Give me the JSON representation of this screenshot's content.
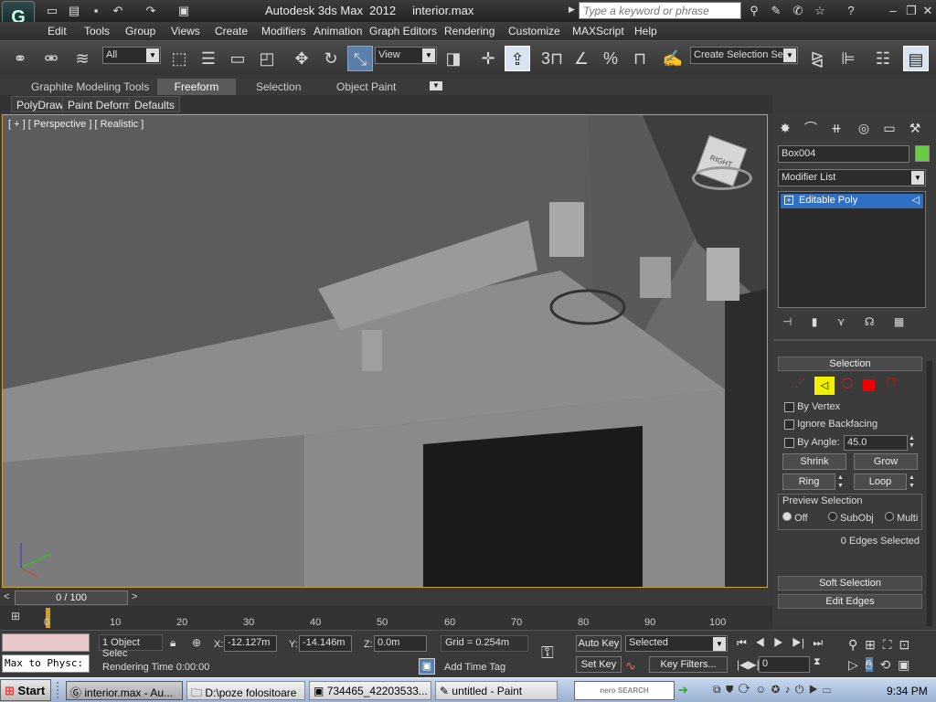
{
  "title": {
    "app": "Autodesk 3ds Max  2012",
    "file": "interior.max",
    "search_placeholder": "Type a keyword or phrase"
  },
  "menu": [
    "Edit",
    "Tools",
    "Group",
    "Views",
    "Create",
    "Modifiers",
    "Animation",
    "Graph Editors",
    "Rendering",
    "Customize",
    "MAXScript",
    "Help"
  ],
  "toolbar": {
    "filter": "All",
    "refcoord": "View",
    "selset": "Create Selection Se"
  },
  "ribbon": {
    "tabs": [
      "Graphite Modeling Tools",
      "Freeform",
      "Selection",
      "Object Paint"
    ],
    "active_tab": "Freeform",
    "buttons": [
      "PolyDraw",
      "Paint Deform",
      "Defaults"
    ]
  },
  "viewport": {
    "label": "[ + ] [ Perspective ] [ Realistic ]",
    "viewcube": "RIGHT"
  },
  "command_panel": {
    "object_name": "Box004",
    "object_color": "#66cc44",
    "modifier_list": "Modifier List",
    "stack_item": "Editable Poly",
    "selection": {
      "title": "Selection",
      "by_vertex": "By Vertex",
      "ignore_backfacing": "Ignore Backfacing",
      "by_angle": "By Angle:",
      "angle_value": "45.0",
      "shrink": "Shrink",
      "grow": "Grow",
      "ring": "Ring",
      "loop": "Loop",
      "preview_title": "Preview Selection",
      "preview_off": "Off",
      "preview_subobj": "SubObj",
      "preview_multi": "Multi",
      "status": "0 Edges Selected"
    },
    "soft_selection": "Soft Selection",
    "edit_edges": "Edit Edges"
  },
  "timeline": {
    "frame": "0 / 100",
    "ticks": [
      "0",
      "10",
      "20",
      "30",
      "40",
      "50",
      "60",
      "70",
      "80",
      "90",
      "100"
    ]
  },
  "status": {
    "maxscript_text": "Max to Physc:",
    "selected": "1 Object Selec",
    "x_label": "X:",
    "x": "-12.127m",
    "y_label": "Y:",
    "y": "-14.146m",
    "z_label": "Z:",
    "z": "0.0m",
    "grid": "Grid = 0.254m",
    "rendering_time": "Rendering Time  0:00:00",
    "add_time_tag": "Add Time Tag",
    "auto_key": "Auto Key",
    "set_key": "Set Key",
    "key_mode": "Selected",
    "key_filters": "Key Filters...",
    "frame_field": "0"
  },
  "taskbar": {
    "start": "Start",
    "tasks": [
      "interior.max - Au...",
      "D:\\poze folositoare",
      "734465_42203533...",
      "untitled - Paint"
    ],
    "nero": "nero SEARCH",
    "clock": "9:34 PM"
  }
}
